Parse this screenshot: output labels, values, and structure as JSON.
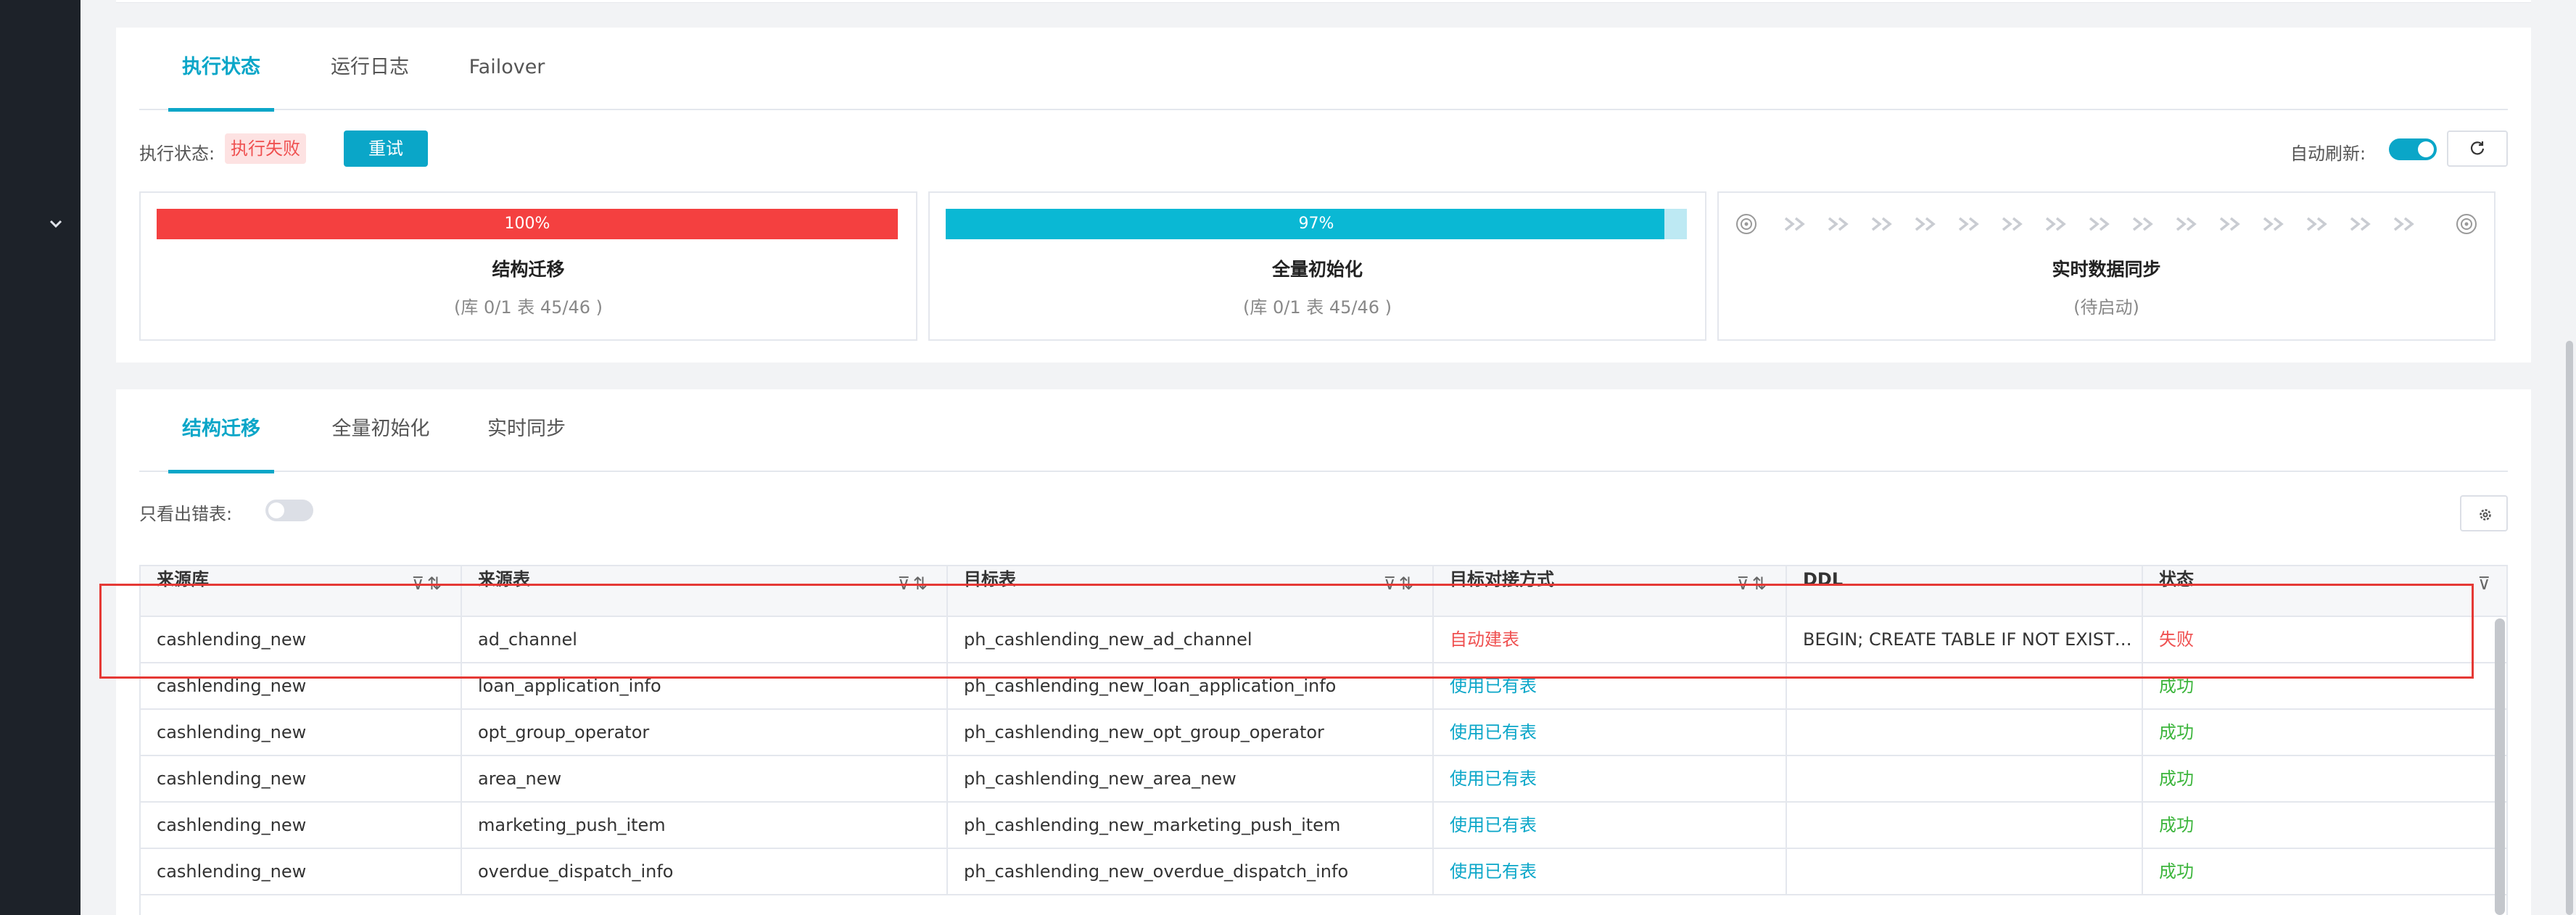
{
  "status_tabs": [
    {
      "label": "执行状态",
      "active": true
    },
    {
      "label": "运行日志",
      "active": false
    },
    {
      "label": "Failover",
      "active": false
    }
  ],
  "execution": {
    "status_label": "执行状态:",
    "status_value": "执行失败",
    "retry_label": "重试",
    "auto_refresh_label": "自动刷新:",
    "auto_refresh_on": true
  },
  "stages": [
    {
      "title": "结构迁移",
      "progress_percent": 100,
      "progress_label": "100%",
      "detail": "(库 0/1 表 45/46 )",
      "color": "#f44040"
    },
    {
      "title": "全量初始化",
      "progress_percent": 97,
      "progress_label": "97%",
      "detail": "(库 0/1 表 45/46 )",
      "color": "#0ab8d4"
    },
    {
      "title": "实时数据同步",
      "detail": "(待启动)"
    }
  ],
  "detail_tabs": [
    {
      "label": "结构迁移",
      "active": true
    },
    {
      "label": "全量初始化",
      "active": false
    },
    {
      "label": "实时同步",
      "active": false
    }
  ],
  "filter": {
    "only_errors_label": "只看出错表:",
    "only_errors_on": false
  },
  "table": {
    "columns": [
      "来源库",
      "来源表",
      "目标表",
      "目标对接方式",
      "DDL",
      "状态"
    ],
    "rows": [
      {
        "source_db": "cashlending_new",
        "source_table": "ad_channel",
        "target_table": "ph_cashlending_new_ad_channel",
        "mode": "自动建表",
        "ddl": "BEGIN; CREATE TABLE IF NOT EXISTS q...",
        "status": "失败"
      },
      {
        "source_db": "cashlending_new",
        "source_table": "loan_application_info",
        "target_table": "ph_cashlending_new_loan_application_info",
        "mode": "使用已有表",
        "ddl": "",
        "status": "成功"
      },
      {
        "source_db": "cashlending_new",
        "source_table": "opt_group_operator",
        "target_table": "ph_cashlending_new_opt_group_operator",
        "mode": "使用已有表",
        "ddl": "",
        "status": "成功"
      },
      {
        "source_db": "cashlending_new",
        "source_table": "area_new",
        "target_table": "ph_cashlending_new_area_new",
        "mode": "使用已有表",
        "ddl": "",
        "status": "成功"
      },
      {
        "source_db": "cashlending_new",
        "source_table": "marketing_push_item",
        "target_table": "ph_cashlending_new_marketing_push_item",
        "mode": "使用已有表",
        "ddl": "",
        "status": "成功"
      },
      {
        "source_db": "cashlending_new",
        "source_table": "overdue_dispatch_info",
        "target_table": "ph_cashlending_new_overdue_dispatch_info",
        "mode": "使用已有表",
        "ddl": "",
        "status": "成功"
      }
    ]
  },
  "colors": {
    "accent": "#0aa6c8",
    "error": "#ef5050",
    "success": "#3cb53c"
  }
}
